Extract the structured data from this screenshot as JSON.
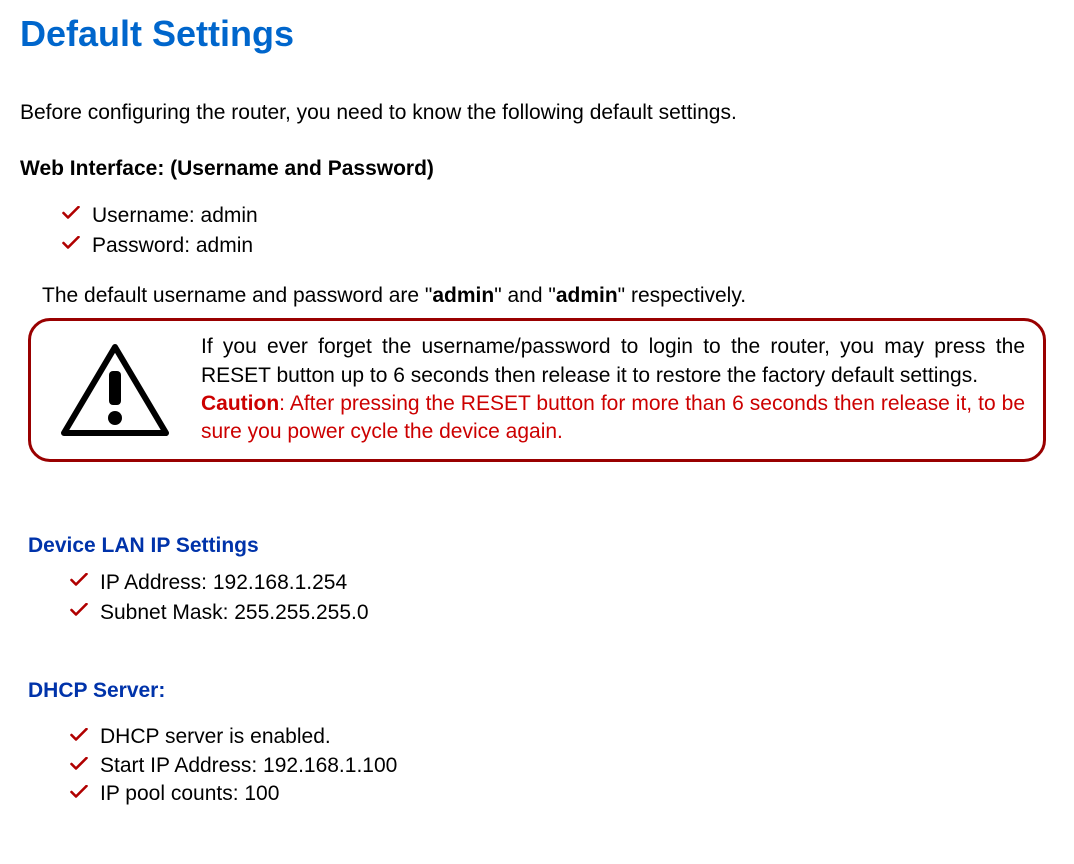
{
  "title": "Default Settings",
  "intro": "Before configuring the router, you need to know the following default settings.",
  "web_interface": {
    "heading": "Web Interface: (Username and Password)",
    "items": [
      "Username: admin",
      "Password: admin"
    ],
    "note_prefix": "The default username and password are \"",
    "note_bold1": "admin",
    "note_mid": "\" and \"",
    "note_bold2": "admin",
    "note_suffix": "\" respectively."
  },
  "callout": {
    "line1": "If you ever forget the username/password to login to the router, you may press the RESET button up to 6 seconds then release it to restore the factory default settings.",
    "caution_label": "Caution",
    "caution_text": ": After pressing the RESET button for more than 6 seconds then release it, to be sure you power cycle the device again."
  },
  "lan": {
    "heading": "Device LAN IP Settings",
    "items": [
      "IP Address: 192.168.1.254",
      "Subnet Mask: 255.255.255.0"
    ]
  },
  "dhcp": {
    "heading": "DHCP Server:",
    "items": [
      "DHCP server is enabled.",
      "Start IP Address: 192.168.1.100",
      "IP pool counts: 100"
    ]
  }
}
